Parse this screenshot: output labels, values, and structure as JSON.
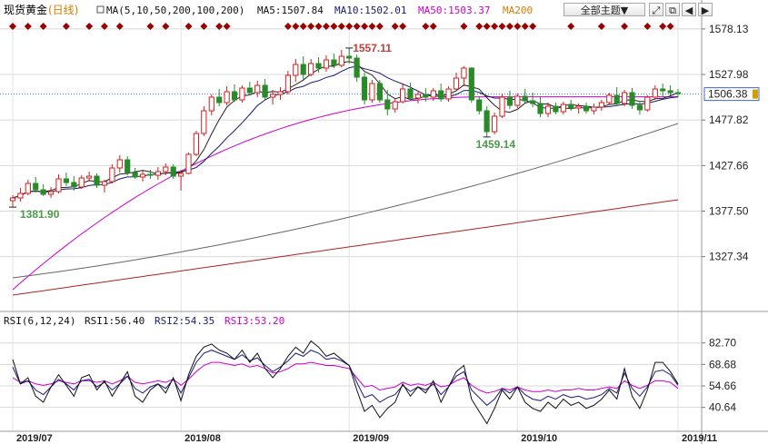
{
  "header": {
    "instrument": "现货黄金",
    "period": "(日线)",
    "ma_label": "MA(5,10,50,200,100,200)",
    "ma5": "MA5:1507.84",
    "ma10": "MA10:1502.01",
    "ma50": "MA50:1503.37",
    "ma200": "MA200",
    "theme_button": "全部主题▼",
    "icon_buttons": [
      "expand-icon",
      "restore-icon",
      "prev-icon",
      "next-icon"
    ]
  },
  "rsi_header": {
    "label": "RSI(6,12,24)",
    "rsi1": "RSI1:56.40",
    "rsi2": "RSI2:54.35",
    "rsi3": "RSI3:53.20"
  },
  "price_axis": {
    "ticks": [
      "1578.13",
      "1527.98",
      "1477.82",
      "1427.66",
      "1377.50",
      "1327.34"
    ],
    "tick_values": [
      1578.13,
      1527.98,
      1477.82,
      1427.66,
      1377.5,
      1327.34
    ],
    "ylim": [
      1292,
      1590
    ],
    "current": 1506.38,
    "current_label": "1506.38"
  },
  "rsi_axis": {
    "ticks": [
      "82.70",
      "68.68",
      "54.66",
      "40.64"
    ],
    "tick_values": [
      82.7,
      68.68,
      54.66,
      40.64
    ],
    "ylim": [
      28,
      92
    ]
  },
  "date_axis": [
    "2019/07",
    "2019/08",
    "2019/09",
    "2019/10",
    "2019/11"
  ],
  "date_axis_positions": [
    0,
    22,
    44,
    66,
    87
  ],
  "annotations": [
    {
      "text": "1381.90",
      "index": 0,
      "value": 1381.9,
      "type": "low"
    },
    {
      "text": "1557.11",
      "index": 44,
      "value": 1557.11,
      "type": "high"
    },
    {
      "text": "1459.14",
      "index": 62,
      "value": 1459.14,
      "type": "low"
    }
  ],
  "colors": {
    "up": "#d02020",
    "down": "#2a8a2a",
    "ma5": "#222222",
    "ma10": "#1a1a6e",
    "ma50": "#cc00cc",
    "ma100": "#666666",
    "ma200": "#b02020",
    "marker": "#990000",
    "rsi1": "#111111",
    "rsi2": "#1a1a80",
    "rsi3": "#cc00cc",
    "grid": "#d8d8d8",
    "label_green": "#4a9a4a",
    "label_red": "#c04040"
  },
  "chart_data": {
    "type": "candlestick",
    "x_axis": "date",
    "candles": [
      [
        1389,
        1395,
        1382,
        1392
      ],
      [
        1392,
        1403,
        1388,
        1397
      ],
      [
        1397,
        1412,
        1395,
        1408
      ],
      [
        1408,
        1415,
        1398,
        1401
      ],
      [
        1401,
        1407,
        1394,
        1396
      ],
      [
        1396,
        1404,
        1392,
        1399
      ],
      [
        1399,
        1418,
        1397,
        1413
      ],
      [
        1413,
        1420,
        1405,
        1409
      ],
      [
        1409,
        1416,
        1400,
        1404
      ],
      [
        1404,
        1417,
        1402,
        1414
      ],
      [
        1414,
        1421,
        1410,
        1416
      ],
      [
        1416,
        1419,
        1403,
        1406
      ],
      [
        1406,
        1412,
        1398,
        1410
      ],
      [
        1410,
        1429,
        1408,
        1425
      ],
      [
        1425,
        1439,
        1420,
        1434
      ],
      [
        1434,
        1438,
        1417,
        1420
      ],
      [
        1420,
        1425,
        1413,
        1415
      ],
      [
        1415,
        1422,
        1410,
        1418
      ],
      [
        1418,
        1423,
        1413,
        1417
      ],
      [
        1417,
        1426,
        1412,
        1421
      ],
      [
        1421,
        1430,
        1417,
        1426
      ],
      [
        1426,
        1429,
        1413,
        1416
      ],
      [
        1416,
        1423,
        1400,
        1419
      ],
      [
        1419,
        1442,
        1418,
        1440
      ],
      [
        1440,
        1466,
        1438,
        1463
      ],
      [
        1463,
        1493,
        1460,
        1488
      ],
      [
        1488,
        1506,
        1483,
        1503
      ],
      [
        1503,
        1512,
        1493,
        1497
      ],
      [
        1497,
        1515,
        1494,
        1509
      ],
      [
        1509,
        1517,
        1498,
        1500
      ],
      [
        1500,
        1516,
        1497,
        1513
      ],
      [
        1513,
        1520,
        1505,
        1508
      ],
      [
        1508,
        1521,
        1503,
        1516
      ],
      [
        1516,
        1523,
        1500,
        1503
      ],
      [
        1503,
        1511,
        1495,
        1506
      ],
      [
        1506,
        1514,
        1500,
        1509
      ],
      [
        1509,
        1532,
        1506,
        1527
      ],
      [
        1527,
        1545,
        1520,
        1539
      ],
      [
        1539,
        1548,
        1522,
        1528
      ],
      [
        1528,
        1545,
        1526,
        1540
      ],
      [
        1540,
        1547,
        1530,
        1535
      ],
      [
        1535,
        1549,
        1531,
        1544
      ],
      [
        1544,
        1551,
        1535,
        1538
      ],
      [
        1538,
        1555,
        1536,
        1548
      ],
      [
        1548,
        1557,
        1540,
        1546
      ],
      [
        1546,
        1550,
        1520,
        1525
      ],
      [
        1525,
        1530,
        1495,
        1500
      ],
      [
        1500,
        1522,
        1497,
        1518
      ],
      [
        1518,
        1522,
        1497,
        1500
      ],
      [
        1500,
        1511,
        1483,
        1490
      ],
      [
        1490,
        1502,
        1486,
        1498
      ],
      [
        1498,
        1517,
        1496,
        1512
      ],
      [
        1512,
        1519,
        1499,
        1502
      ],
      [
        1502,
        1509,
        1496,
        1506
      ],
      [
        1506,
        1513,
        1498,
        1503
      ],
      [
        1503,
        1513,
        1499,
        1510
      ],
      [
        1510,
        1518,
        1498,
        1501
      ],
      [
        1501,
        1515,
        1498,
        1512
      ],
      [
        1512,
        1530,
        1510,
        1524
      ],
      [
        1524,
        1537,
        1515,
        1535
      ],
      [
        1535,
        1536,
        1497,
        1500
      ],
      [
        1500,
        1504,
        1484,
        1488
      ],
      [
        1488,
        1493,
        1459,
        1465
      ],
      [
        1465,
        1486,
        1462,
        1482
      ],
      [
        1482,
        1507,
        1480,
        1503
      ],
      [
        1503,
        1510,
        1490,
        1494
      ],
      [
        1494,
        1507,
        1491,
        1504
      ],
      [
        1504,
        1512,
        1497,
        1499
      ],
      [
        1499,
        1508,
        1492,
        1496
      ],
      [
        1496,
        1503,
        1481,
        1485
      ],
      [
        1485,
        1497,
        1481,
        1493
      ],
      [
        1493,
        1497,
        1484,
        1487
      ],
      [
        1487,
        1498,
        1484,
        1495
      ],
      [
        1495,
        1500,
        1488,
        1491
      ],
      [
        1491,
        1496,
        1485,
        1493
      ],
      [
        1493,
        1497,
        1485,
        1488
      ],
      [
        1488,
        1496,
        1484,
        1492
      ],
      [
        1492,
        1500,
        1488,
        1497
      ],
      [
        1497,
        1508,
        1494,
        1505
      ],
      [
        1505,
        1514,
        1493,
        1496
      ],
      [
        1496,
        1511,
        1493,
        1508
      ],
      [
        1508,
        1513,
        1490,
        1494
      ],
      [
        1494,
        1499,
        1484,
        1489
      ],
      [
        1489,
        1505,
        1487,
        1503
      ],
      [
        1503,
        1516,
        1500,
        1512
      ],
      [
        1512,
        1518,
        1503,
        1510
      ],
      [
        1510,
        1516,
        1505,
        1508
      ],
      [
        1508,
        1512,
        1503,
        1507
      ]
    ],
    "ma_start": {
      "ma50": 1291,
      "ma100": 1304,
      "ma200": 1285
    },
    "ma_end": {
      "ma50": 1503.37,
      "ma100": 1474.0,
      "ma200": 1390.0
    },
    "marker_indices": [
      0,
      2,
      4,
      7,
      10,
      12,
      14,
      18,
      20,
      23,
      25,
      27,
      28,
      36,
      37,
      38,
      39,
      40,
      41,
      42,
      43,
      44,
      45,
      46,
      47,
      48,
      50,
      51,
      54,
      55,
      59,
      61,
      62,
      63,
      64,
      65,
      66,
      67,
      68,
      73,
      77,
      80,
      83,
      85,
      86
    ],
    "rsi1": [
      72,
      56,
      60,
      48,
      44,
      54,
      62,
      55,
      48,
      60,
      62,
      52,
      58,
      48,
      56,
      64,
      48,
      44,
      52,
      56,
      50,
      60,
      45,
      62,
      74,
      80,
      82,
      78,
      76,
      72,
      78,
      70,
      76,
      66,
      60,
      66,
      74,
      80,
      76,
      84,
      80,
      74,
      76,
      72,
      68,
      52,
      38,
      42,
      34,
      40,
      44,
      56,
      48,
      54,
      50,
      58,
      44,
      54,
      64,
      68,
      46,
      38,
      30,
      40,
      52,
      46,
      54,
      44,
      40,
      38,
      44,
      40,
      46,
      42,
      44,
      40,
      42,
      46,
      52,
      46,
      66,
      48,
      40,
      52,
      70,
      70,
      64,
      56
    ],
    "rsi2": [
      67,
      56,
      58,
      52,
      49,
      54,
      59,
      56,
      52,
      58,
      59,
      54,
      57,
      52,
      56,
      61,
      53,
      50,
      54,
      56,
      53,
      59,
      50,
      60,
      70,
      76,
      78,
      76,
      74,
      72,
      75,
      71,
      73,
      68,
      64,
      67,
      71,
      76,
      74,
      78,
      76,
      72,
      73,
      71,
      68,
      57,
      47,
      49,
      44,
      47,
      49,
      55,
      51,
      54,
      52,
      56,
      49,
      54,
      61,
      64,
      52,
      47,
      42,
      46,
      53,
      50,
      54,
      49,
      46,
      45,
      48,
      46,
      49,
      47,
      48,
      46,
      47,
      49,
      53,
      50,
      63,
      53,
      48,
      54,
      64,
      65,
      62,
      55
    ],
    "rsi3": [
      60,
      57,
      58,
      56,
      55,
      56,
      58,
      57,
      56,
      58,
      58,
      57,
      58,
      56,
      58,
      61,
      57,
      56,
      57,
      58,
      57,
      59,
      55,
      59,
      64,
      68,
      70,
      70,
      69,
      68,
      69,
      67,
      68,
      66,
      63,
      64,
      66,
      69,
      69,
      70,
      69,
      68,
      68,
      67,
      66,
      60,
      54,
      55,
      52,
      53,
      54,
      57,
      55,
      56,
      55,
      57,
      54,
      55,
      58,
      60,
      55,
      52,
      50,
      51,
      53,
      52,
      54,
      52,
      51,
      51,
      52,
      51,
      52,
      52,
      53,
      52,
      52,
      53,
      54,
      53,
      58,
      55,
      53,
      55,
      58,
      58,
      57,
      53
    ]
  }
}
